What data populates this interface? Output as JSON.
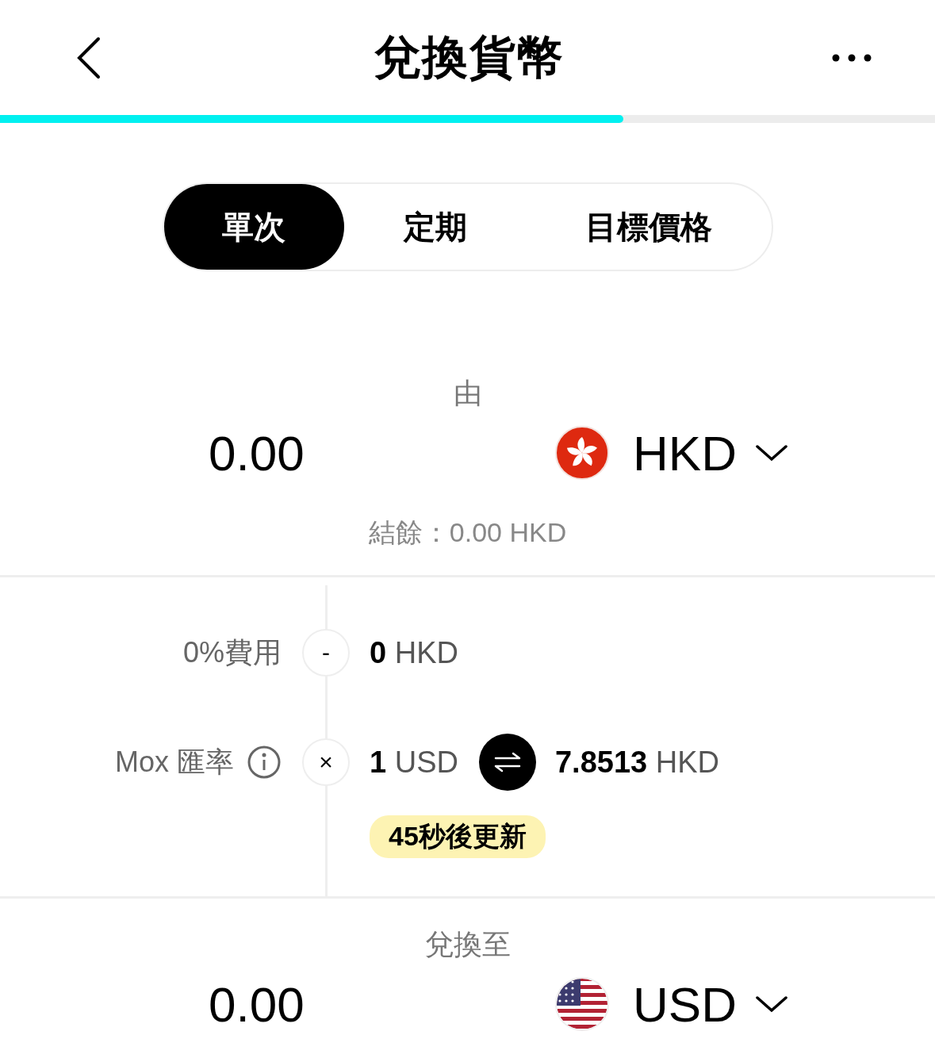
{
  "header": {
    "title": "兌換貨幣"
  },
  "progress": {
    "level": 0.667
  },
  "tabs": [
    {
      "label": "單次",
      "selected": true
    },
    {
      "label": "定期",
      "selected": false
    },
    {
      "label": "目標價格",
      "selected": false
    }
  ],
  "from": {
    "label": "由",
    "amount": "0.00",
    "currency": "HKD",
    "balance": "結餘：0.00 HKD"
  },
  "breakdown": [
    {
      "label": "0%費用",
      "info": false,
      "operator": "-",
      "value": "**0** HKD"
    },
    {
      "label": "Mox 匯率",
      "info": true,
      "operator": "×",
      "value": "**1** USD",
      "converted": "**7.8513** HKD"
    }
  ],
  "refresh_badge": "45秒後更新",
  "to": {
    "label": "兌換至",
    "amount": "0.00",
    "currency": "USD"
  }
}
